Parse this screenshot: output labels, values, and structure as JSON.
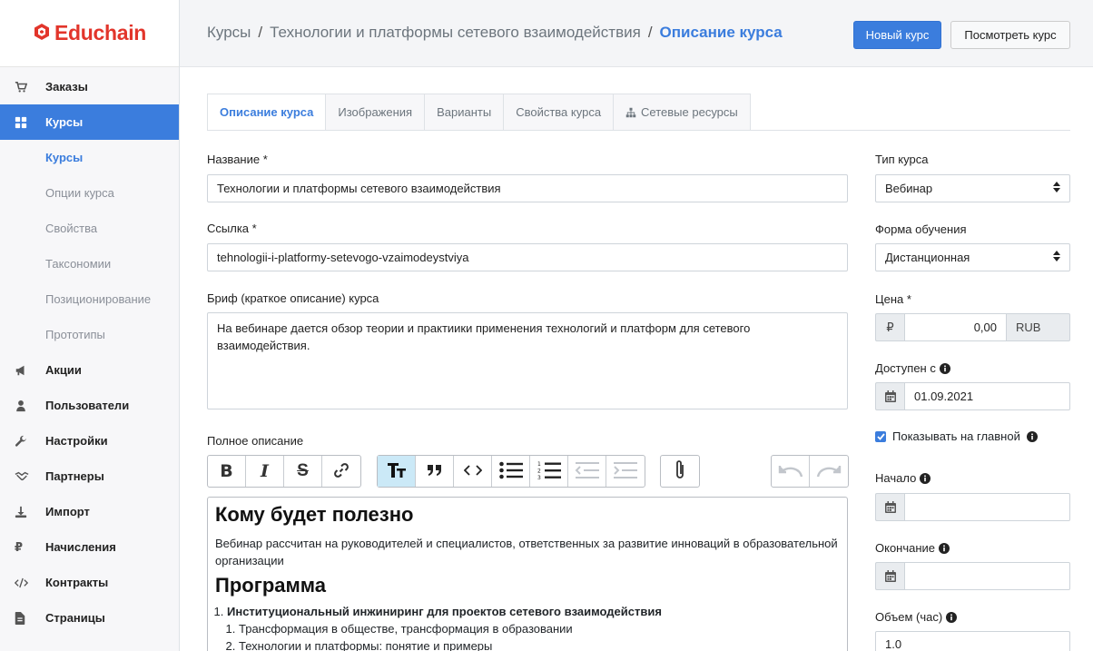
{
  "brand": {
    "name": "Educhain",
    "color": "#e2352b"
  },
  "accent": "#3b7ddd",
  "sidebar": {
    "items": [
      {
        "label": "Заказы",
        "icon": "cart-icon"
      },
      {
        "label": "Курсы",
        "icon": "grid-icon",
        "active": true
      },
      {
        "label": "Акции",
        "icon": "megaphone-icon"
      },
      {
        "label": "Пользователи",
        "icon": "user-icon"
      },
      {
        "label": "Настройки",
        "icon": "wrench-icon"
      },
      {
        "label": "Партнеры",
        "icon": "handshake-icon"
      },
      {
        "label": "Импорт",
        "icon": "download-icon"
      },
      {
        "label": "Начисления",
        "icon": "ruble-icon"
      },
      {
        "label": "Контракты",
        "icon": "code-icon"
      },
      {
        "label": "Страницы",
        "icon": "file-icon"
      }
    ],
    "sub_items": [
      "Курсы",
      "Опции курса",
      "Свойства",
      "Таксономии",
      "Позиционирование",
      "Прототипы"
    ]
  },
  "breadcrumb": {
    "items": [
      "Курсы",
      "Технологии и платформы сетевого взаимодействия"
    ],
    "current": "Описание курса"
  },
  "header": {
    "new_course": "Новый курс",
    "view_course": "Посмотреть курс"
  },
  "tabs": [
    "Описание курса",
    "Изображения",
    "Варианты",
    "Свойства курса",
    "Сетевые ресурсы"
  ],
  "form": {
    "name_label": "Название *",
    "name_value": "Технологии и платформы сетевого взаимодействия",
    "slug_label": "Ссылка *",
    "slug_value": "tehnologii-i-platformy-setevogo-vzaimodeystviya",
    "brief_label": "Бриф (краткое описание) курса",
    "brief_value": "На вебинаре дается обзор теории и практиики применения технологий и платформ для сетевого взаимодействия.",
    "full_label": "Полное описание"
  },
  "editor": {
    "heading1": "Кому будет полезно",
    "para1": "Вебинар рассчитан на руководителей и специалистов, ответственных за развитие инноваций в образовательной организации",
    "heading2": "Программа",
    "list_item1": "Институциональный инжиниринг для проектов сетевого взаимодействия",
    "sub_items": [
      "Трансформация в обществе, трансформация в образовании",
      "Технологии и платформы: понятие и примеры"
    ]
  },
  "side": {
    "type_label": "Тип курса",
    "type_value": "Вебинар",
    "form_label": "Форма обучения",
    "form_value": "Дистанционная",
    "price_label": "Цена *",
    "price_currency_symbol": "₽",
    "price_value": "0,00",
    "price_currency": "RUB",
    "available_label": "Доступен с",
    "available_value": "01.09.2021",
    "show_main_label": "Показывать на главной",
    "show_main_checked": true,
    "start_label": "Начало",
    "start_value": "",
    "end_label": "Окончание",
    "end_value": "",
    "volume_label": "Объем (час)",
    "volume_value": "1.0"
  }
}
